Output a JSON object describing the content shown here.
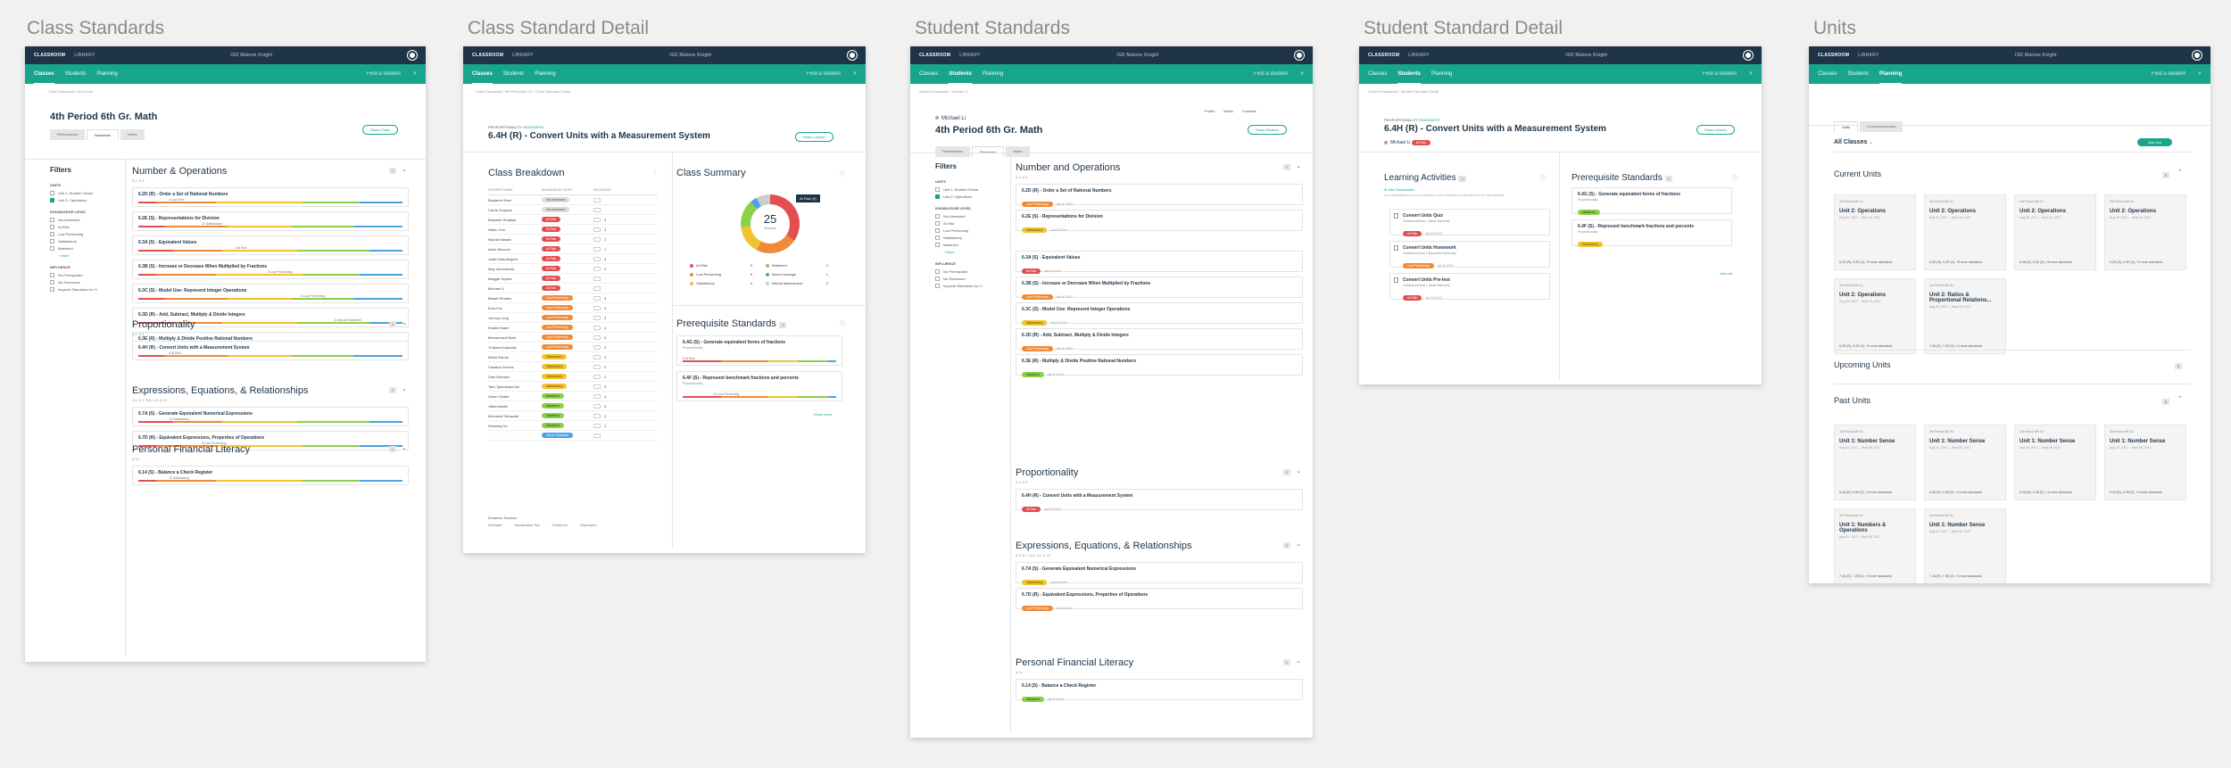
{
  "boards": {
    "b1": "Class Standards",
    "b2": "Class Standard Detail",
    "b3": "Student Standards",
    "b4": "Student Standard Detail",
    "b5": "Units"
  },
  "app": {
    "brand": "CLASSROOM",
    "library": "LIBRARY",
    "school": "ISD Malone Knight",
    "tabs": [
      "Classes",
      "Students",
      "Planning"
    ],
    "find": "Find a student"
  },
  "s1": {
    "crumb": "Class Standards / All Levels",
    "title": "4th Period 6th Gr. Math",
    "btn": "Share Class",
    "subtabs": [
      "Performance",
      "Standards",
      "Notes"
    ],
    "filters": {
      "title": "Filters",
      "units": "UNITS",
      "unitItems": [
        "Unit 1: Number Sense",
        "Unit 2: Operations"
      ],
      "knowledge": "KNOWLEDGE LEVEL",
      "knowledgeItems": [
        "Not Assessed",
        "At Risk",
        "Low Performing",
        "Satisfactory",
        "Mastered",
        "+ More"
      ],
      "influence": "INFLUENCE",
      "influenceItems": [
        "No Prerequisite",
        "No Successor",
        "Impacts Standards for Yr"
      ]
    },
    "sections": [
      {
        "title": "Number & Operations",
        "sub": "6.2, 6.3",
        "count": "7",
        "cards": [
          {
            "t": "6.2D (R) - Order a Set of Rational Numbers",
            "m": "4 Low Perf."
          },
          {
            "t": "6.2E (S) - Representations for Division",
            "m": "12 Satisfactory"
          },
          {
            "t": "6.3A (S) - Equivalent Values",
            "m": "3 At Risk"
          },
          {
            "t": "6.3B (S) - Increase or Decrease When Multiplied by Fractions",
            "m": "6 Low Performing"
          },
          {
            "t": "6.3C (S) - Model Use: Represent Integer Operations",
            "m": "5 Low Performing"
          },
          {
            "t": "6.3D (R) - Add, Subtract, Multiply & Divide Integers",
            "m": "11 Almost Mastered"
          },
          {
            "t": "6.3E (R) - Multiply & Divide Positive Rational Numbers",
            "m": "10 Satisfactory"
          }
        ]
      },
      {
        "title": "Proportionality",
        "sub": "6.4, 6.5",
        "count": "1",
        "cards": [
          {
            "t": "6.4H (R) - Convert Units with a Measurement System",
            "m": "6 At Risk"
          }
        ]
      },
      {
        "title": "Expressions, Equations, & Relationships",
        "sub": "6.6, 6.7, 6.8, 6.9, 6.10",
        "count": "2",
        "cards": [
          {
            "t": "6.7A (S) - Generate Equivalent Numerical Expressions",
            "m": "12 Satisfactory"
          },
          {
            "t": "6.7D (R) - Equivalent Expressions, Properties of Operations",
            "m": "8 Low Performing"
          }
        ]
      },
      {
        "title": "Personal Financial Literacy",
        "sub": "6.14",
        "count": "1",
        "cards": [
          {
            "t": "6.14 (S) - Balance a Check Register",
            "m": "10 Satisfactory"
          }
        ]
      }
    ]
  },
  "s2": {
    "crumb": "Class Standards / 6th Period 6th Gr. / Class Standard Detail",
    "kicker": "PROPORTIONALITY",
    "kickerTag": "READINESS",
    "title": "6.4H (R) - Convert Units with a Measurement System",
    "btn": "Share Lesson",
    "breakdown": "Class Breakdown",
    "cols": [
      "STUDENT NAME",
      "KNOWLEDGE LEVEL",
      "INFLUENCE"
    ],
    "students": [
      {
        "n": "Benjamin Noel",
        "l": "Not Assessed",
        "c": "p-grey",
        "v": ""
      },
      {
        "n": "Carrie Grayson",
        "l": "Not Assessed",
        "c": "p-grey",
        "v": ""
      },
      {
        "n": "Bhavesh Shakkar",
        "l": "At Risk",
        "c": "p-red",
        "v": "3"
      },
      {
        "n": "Helen Cho",
        "l": "At Risk",
        "c": "p-red",
        "v": "3"
      },
      {
        "n": "Randa Nakata",
        "l": "At Risk",
        "c": "p-red",
        "v": "2"
      },
      {
        "n": "Isaac Moncon",
        "l": "At Risk",
        "c": "p-red",
        "v": "1"
      },
      {
        "n": "Justin Mandergren",
        "l": "At Risk",
        "c": "p-red",
        "v": "3"
      },
      {
        "n": "May Zammanda",
        "l": "At Risk",
        "c": "p-red",
        "v": "2"
      },
      {
        "n": "Maggie Snyder",
        "l": "At Risk",
        "c": "p-red",
        "v": ""
      },
      {
        "n": "Michael Li",
        "l": "At Risk",
        "c": "p-red",
        "v": ""
      },
      {
        "n": "Bekah Rhodes",
        "l": "Low Performing",
        "c": "p-orange",
        "v": "3"
      },
      {
        "n": "Ezra Fox",
        "l": "Low Performing",
        "c": "p-orange",
        "v": "4"
      },
      {
        "n": "Johnny Leng",
        "l": "Low Performing",
        "c": "p-orange",
        "v": "3"
      },
      {
        "n": "Khaled Nasri",
        "l": "Low Performing",
        "c": "p-orange",
        "v": "4"
      },
      {
        "n": "Mohammed Bosh",
        "l": "Low Performing",
        "c": "p-orange",
        "v": "5"
      },
      {
        "n": "Trudora Kurpanko",
        "l": "Low Performing",
        "c": "p-orange",
        "v": "3"
      },
      {
        "n": "Maria Rando",
        "l": "Satisfactory",
        "c": "p-yellow",
        "v": "4"
      },
      {
        "n": "Catalina Gomez",
        "l": "Satisfactory",
        "c": "p-yellow",
        "v": "2"
      },
      {
        "n": "Sam Ramirez",
        "l": "Satisfactory",
        "c": "p-yellow",
        "v": "3"
      },
      {
        "n": "Tara Tyandunpa Ani",
        "l": "Satisfactory",
        "c": "p-yellow",
        "v": "3"
      },
      {
        "n": "Owen Okafor",
        "l": "Mastered",
        "c": "p-green",
        "v": "4"
      },
      {
        "n": "Jillian Martin",
        "l": "Mastered",
        "c": "p-green",
        "v": "3"
      },
      {
        "n": "Michaela Slezanski",
        "l": "Mastered",
        "c": "p-green",
        "v": "2"
      },
      {
        "n": "Weiming Hu",
        "l": "Mastered",
        "c": "p-green",
        "v": "2"
      },
      {
        "n": "",
        "l": "Above Standard",
        "c": "p-blue",
        "v": ""
      }
    ],
    "evidence": "Evidence Sources",
    "evidenceItems": [
      "Estimated",
      "Standardized Test",
      "Gradebook",
      "Observation"
    ],
    "summary": "Class Summary",
    "donutValue": "25",
    "donutLabel": "Students",
    "donutTip": "At Risk (9)",
    "legend": [
      {
        "k": "At Risk",
        "v": "9",
        "c": "#e34f4f"
      },
      {
        "k": "Mastered",
        "v": "4",
        "c": "#8bd04a"
      },
      {
        "k": "Low Performing",
        "v": "6",
        "c": "#f08a36"
      },
      {
        "k": "Above Average",
        "v": "1",
        "c": "#4aa3e0"
      },
      {
        "k": "Satisfactory",
        "v": "4",
        "c": "#f0c42e"
      },
      {
        "k": "Needs Assessment",
        "v": "2",
        "c": "#cccccc"
      }
    ],
    "chart_data": {
      "type": "pie",
      "categories": [
        "At Risk",
        "Low Performing",
        "Satisfactory",
        "Mastered",
        "Above Average",
        "Needs Assessment"
      ],
      "values": [
        9,
        6,
        4,
        4,
        1,
        2
      ]
    },
    "prereq": "Prerequisite Standards",
    "prereqCount": "2",
    "prereqCards": [
      {
        "t": "6.4G (S) - Generate equivalent forms of fractions",
        "s": "Proportionality",
        "m": "6 At Risk"
      },
      {
        "t": "6.4F (S) - Represent benchmark fractions and percents",
        "s": "Proportionality",
        "m": "10 Low Performing"
      }
    ],
    "showMore": "Show more"
  },
  "s3": {
    "crumb": "Student Standards / Michael Li",
    "student": "Michael Li",
    "title": "4th Period 6th Gr. Math",
    "btn": "Share Student",
    "links": [
      "Profile",
      "Notes",
      "Contacts"
    ],
    "subtabs": [
      "Performance",
      "Standards",
      "Notes"
    ],
    "sections": [
      {
        "title": "Number and Operations",
        "sub": "6.2, 6.3",
        "count": "7",
        "cards": [
          {
            "t": "6.2D (R) - Order a Set of Rational Numbers",
            "l": "Low Performing",
            "c": "p-orange",
            "d": "Jan 8 10/19"
          },
          {
            "t": "6.2E (S) - Representations for Division",
            "l": "Satisfactory",
            "c": "p-yellow",
            "d": "Jan 8 10/19"
          },
          {
            "t": "6.3A (S) - Equivalent Values",
            "l": "At Risk",
            "c": "p-red",
            "d": "Jan 8 10/19"
          },
          {
            "t": "6.3B (S) - Increase or Decrease When Multiplied by Fractions",
            "l": "Low Performing",
            "c": "p-orange",
            "d": "Jan 8 10/19"
          },
          {
            "t": "6.3C (S) - Model Use: Represent Integer Operations",
            "l": "Satisfactory",
            "c": "p-yellow",
            "d": "Jan 8 10/19"
          },
          {
            "t": "6.3D (R) - Add, Subtract, Multiply & Divide Integers",
            "l": "Low Performing",
            "c": "p-orange",
            "d": "Jan 8 10/19"
          },
          {
            "t": "6.3E (R) - Multiply & Divide Positive Rational Numbers",
            "l": "Mastered",
            "c": "p-green",
            "d": "Jan 8 10/19"
          }
        ]
      },
      {
        "title": "Proportionality",
        "sub": "6.4, 6.5",
        "count": "1",
        "cards": [
          {
            "t": "6.4H (R) - Convert Units with a Measurement System",
            "l": "At Risk",
            "c": "p-red",
            "d": "Jan 8 10/19"
          }
        ]
      },
      {
        "title": "Expressions, Equations, & Relationships",
        "sub": "6.6, 6.7, 6.8, 6.9, 6.10",
        "count": "2",
        "cards": [
          {
            "t": "6.7A (S) - Generate Equivalent Numerical Expressions",
            "l": "Satisfactory",
            "c": "p-yellow",
            "d": "Jan 8 10/19"
          },
          {
            "t": "6.7D (R) - Equivalent Expressions, Properties of Operations",
            "l": "Low Performing",
            "c": "p-orange",
            "d": "Jan 8 10/19"
          }
        ]
      },
      {
        "title": "Personal Financial Literacy",
        "sub": "6.14",
        "count": "1",
        "cards": [
          {
            "t": "6.14 (S) - Balance a Check Register",
            "l": "Mastered",
            "c": "p-green",
            "d": "Jan 8 10/19"
          }
        ]
      }
    ]
  },
  "s4": {
    "crumb": "Student Standards / Student Standard Detail",
    "kicker": "PROPORTIONALITY",
    "kickerTag": "READINESS",
    "title": "6.4H (R) - Convert Units with a Measurement System",
    "student": "Michael Li",
    "studentTag": "At Risk",
    "btn": "Share Lesson",
    "activities": "Learning Activities",
    "activitiesCount": "3",
    "addObs": "Add Observation",
    "obsNote": "Use observations to record evidence of this student's knowledge level for this standard.",
    "acts": [
      {
        "t": "Convert Units Quiz",
        "s": "Gradebook Item | Jamie Mahoney",
        "l": "At Risk",
        "d": "Jan 8 10/19"
      },
      {
        "t": "Convert Units Homework",
        "s": "Gradebook Item | Samantha Mahoney",
        "l": "Low Performing",
        "d": "Jan 8 10/19"
      },
      {
        "t": "Convert Units Pre-test",
        "s": "Gradebook Item | Jamie Mahoney",
        "l": "At Risk",
        "d": "Jan 8 10/19"
      }
    ],
    "prereq": "Prerequisite Standards",
    "prereqCount": "2",
    "prereqCards": [
      {
        "t": "6.4G (S) - Generate equivalent forms of fractions",
        "s": "Proportionality",
        "l": "Mastered",
        "c": "p-green"
      },
      {
        "t": "6.4F (S) - Represent benchmark fractions and percents",
        "s": "Proportionality",
        "l": "Satisfactory",
        "c": "p-yellow"
      }
    ],
    "viewAll": "View all"
  },
  "s5": {
    "subtabs": [
      "Units",
      "Learning Activities"
    ],
    "classes": "All Classes",
    "btn": "Add Unit",
    "current": "Current Units",
    "currentCount": "6",
    "upcoming": "Upcoming Units",
    "upcomingCount": "0",
    "past": "Past Units",
    "pastCount": "6",
    "currentTiles": [
      {
        "k": "3rd Period 6th Gr.",
        "t": "Unit 2: Operations",
        "d": "Aug 30, 2017 – Sept 16, 2017",
        "f": "6.2D (R), 6.2E (S), +5 more standards"
      },
      {
        "k": "3rd Period 6th Gr.",
        "t": "Unit 2: Operations",
        "d": "Aug 30, 2017 – Sept 16, 2017",
        "f": "6.2D (R), 6.2E (S), +5 more standards"
      },
      {
        "k": "3rd Period 6th Gr.",
        "t": "Unit 2: Operations",
        "d": "Aug 30, 2017 – Sept 16, 2017",
        "f": "6.3A (R), 6.3E (S), +5 more standards"
      },
      {
        "k": "3rd Period 6th Gr.",
        "t": "Unit 2: Operations",
        "d": "Aug 30, 2017 – Sept 16, 2017",
        "f": "6.2D (R), 6.3E (S), +5 more standards"
      },
      {
        "k": "3rd Period 6th Gr.",
        "t": "Unit 2: Operations",
        "d": "Aug 30, 2017 – Sept 16, 2017",
        "f": "6.2D (R), 6.2E (S), +5 more standards"
      },
      {
        "k": "3rd Period 6th Gr.",
        "t": "Unit 2: Ratios & Proportional Relations...",
        "d": "Aug 30, 2017 – Sept 16, 2017",
        "f": "7.4A (R), 7.4D (S), +4 more standards"
      }
    ],
    "pastTiles": [
      {
        "k": "3rd Period 6th Gr.",
        "t": "Unit 1: Number Sense",
        "d": "Aug 20, 2017 – Sept 08, 2017",
        "f": "6.2A (R), 6.2B (S), +4 more standards"
      },
      {
        "k": "3rd Period 6th Gr.",
        "t": "Unit 1: Number Sense",
        "d": "Aug 20, 2017 – Sept 08, 2017",
        "f": "6.2A (R), 6.2B (S), +4 more standards"
      },
      {
        "k": "3rd Period 6th Gr.",
        "t": "Unit 1: Number Sense",
        "d": "Aug 20, 2017 – Sept 08, 2017",
        "f": "6.2A (R), 6.2B (S), +4 more standards"
      },
      {
        "k": "3rd Period 6th Gr.",
        "t": "Unit 1: Number Sense",
        "d": "Aug 20, 2017 – Sept 08, 2017",
        "f": "6.2A (R), 6.2B (S), +4 more standards"
      },
      {
        "k": "3rd Period 6th Gr.",
        "t": "Unit 1: Numbers & Operations",
        "d": "Aug 20, 2017 – Sept 08, 2017",
        "f": "7.2A (R), 7.2B (S), +4 more standards"
      },
      {
        "k": "3rd Period 6th Gr.",
        "t": "Unit 1: Number Sense",
        "d": "Aug 20, 2017 – Sept 08, 2017",
        "f": "7.2A (R), 7.2B (S), +4 more standards"
      }
    ]
  }
}
